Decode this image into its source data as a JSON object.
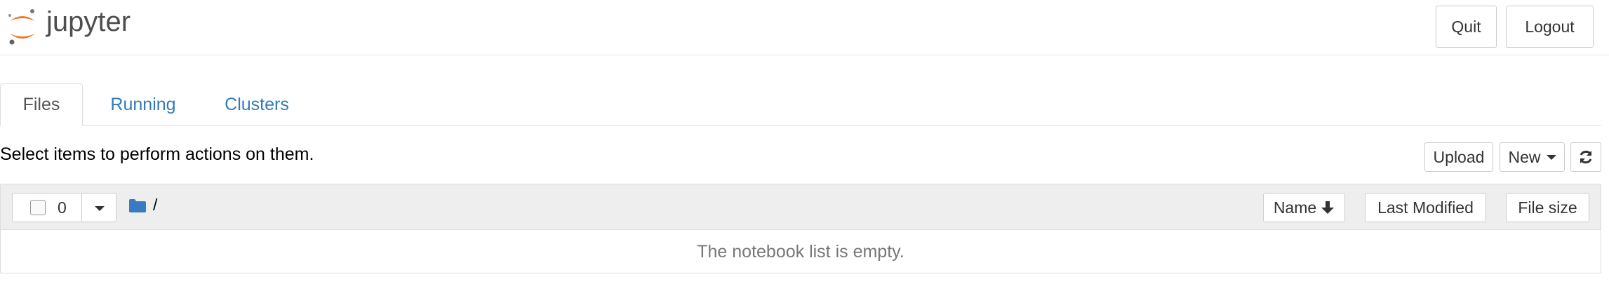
{
  "header": {
    "logo_text": "jupyter",
    "quit_label": "Quit",
    "logout_label": "Logout"
  },
  "tabs": [
    {
      "label": "Files",
      "active": true
    },
    {
      "label": "Running",
      "active": false
    },
    {
      "label": "Clusters",
      "active": false
    }
  ],
  "toolbar": {
    "hint": "Select items to perform actions on them.",
    "upload_label": "Upload",
    "new_label": "New",
    "refresh_icon": "refresh-icon"
  },
  "list": {
    "selected_count": "0",
    "path": "/",
    "columns": {
      "name": "Name",
      "modified": "Last Modified",
      "size": "File size"
    },
    "empty_message": "The notebook list is empty."
  },
  "colors": {
    "link": "#337ab7",
    "logo_orange": "#f37626",
    "logo_gray": "#616262",
    "folder_blue": "#3a7ac0"
  }
}
